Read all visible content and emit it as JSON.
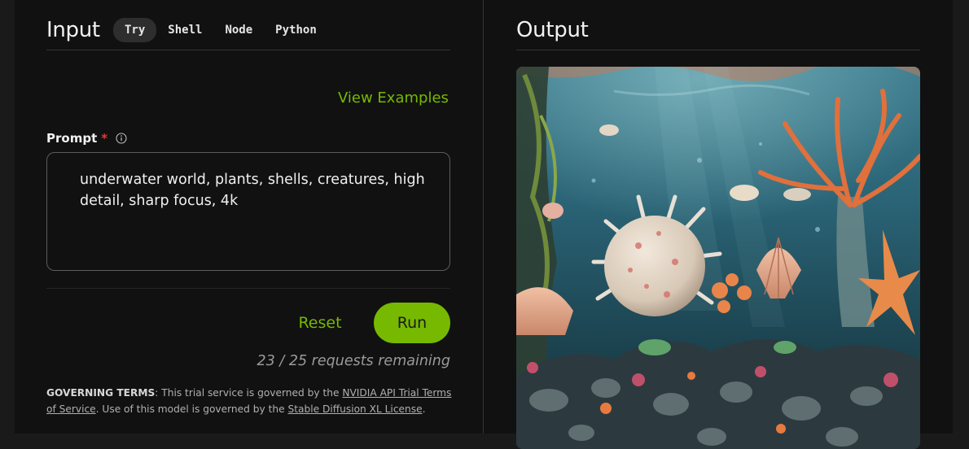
{
  "input": {
    "title": "Input",
    "tabs": [
      {
        "label": "Try",
        "active": true
      },
      {
        "label": "Shell",
        "active": false
      },
      {
        "label": "Node",
        "active": false
      },
      {
        "label": "Python",
        "active": false
      }
    ],
    "view_examples": "View Examples",
    "prompt_label": "Prompt",
    "required_marker": "*",
    "prompt_value": "underwater world, plants, shells, creatures, high detail, sharp focus, 4k",
    "reset_label": "Reset",
    "run_label": "Run",
    "requests_remaining": "23 / 25 requests remaining",
    "terms": {
      "heading": "GOVERNING TERMS",
      "text1": ": This trial service is governed by the ",
      "link1": "NVIDIA API Trial Terms of Service",
      "text2": ". Use of this model is governed by the ",
      "link2": "Stable Diffusion XL License",
      "text3": "."
    }
  },
  "output": {
    "title": "Output"
  },
  "colors": {
    "accent": "#76b900",
    "background": "#111111",
    "required": "#e03c31"
  },
  "icons": {
    "prompt_info": "info-icon"
  }
}
